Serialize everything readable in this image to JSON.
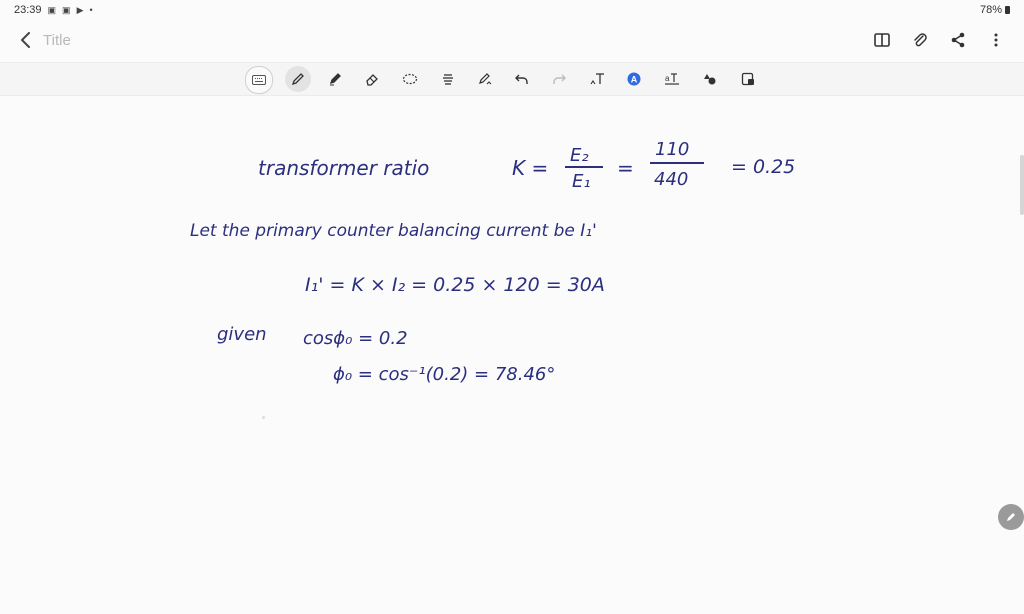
{
  "status_bar": {
    "time": "23:39",
    "battery_percent": "78%"
  },
  "app_bar": {
    "title_placeholder": "Title"
  },
  "toolbar": {
    "tools": [
      "keyboard",
      "pen",
      "highlighter",
      "eraser",
      "lasso",
      "text-align",
      "shape-pen",
      "undo",
      "redo",
      "text-to-shape",
      "color",
      "text-format",
      "shapes",
      "image-insert"
    ],
    "selected": "pen"
  },
  "note": {
    "line1_prefix": "transformer ratio",
    "line1_k": "K =",
    "line1_frac1_num": "E₂",
    "line1_frac1_den": "E₁",
    "line1_eq": "=",
    "line1_frac2_num": "110",
    "line1_frac2_den": "440",
    "line1_result": "= 0.25",
    "line2": "Let the primary counter balancing current be I₁'",
    "line3": "I₁' = K × I₂ = 0.25 × 120 = 30A",
    "line4_given": "given",
    "line4_eq": "cosϕ₀ = 0.2",
    "line5": "ϕ₀ = cos⁻¹(0.2) = 78.46°"
  },
  "colors": {
    "ink": "#2b2f7d",
    "toolbar_bg": "#f5f5f5",
    "page_bg": "#fbfbfb"
  }
}
